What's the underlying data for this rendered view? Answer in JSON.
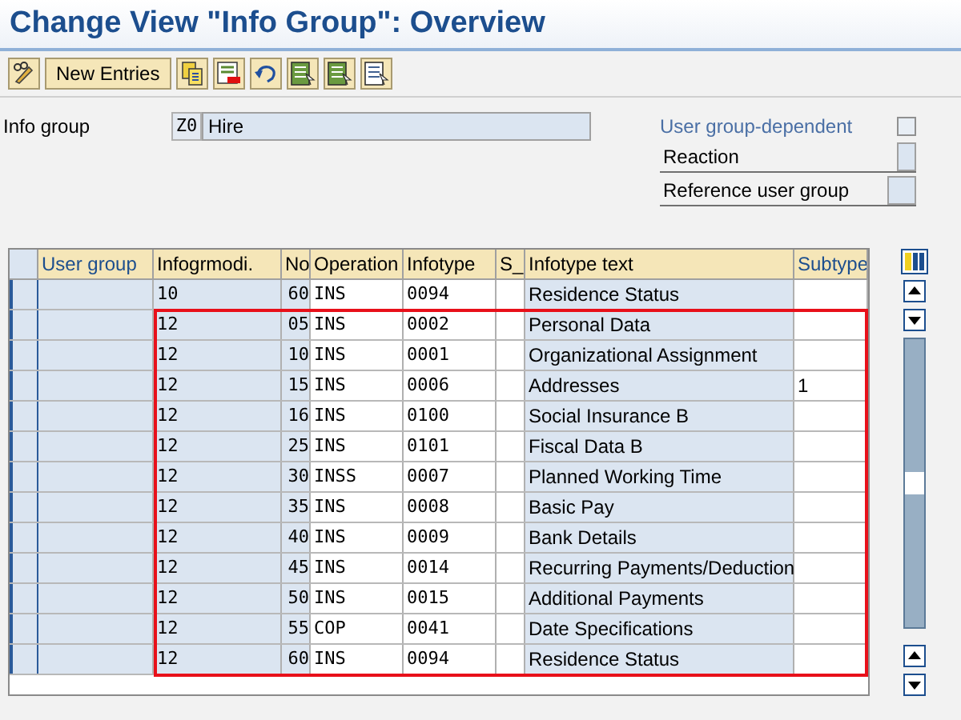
{
  "title": "Change View \"Info Group\": Overview",
  "toolbar": {
    "buttons": [
      {
        "kind": "glasses-pencil"
      },
      {
        "kind": "text",
        "label": "New Entries"
      },
      {
        "kind": "copy"
      },
      {
        "kind": "delete"
      },
      {
        "kind": "undo"
      },
      {
        "kind": "select-all"
      },
      {
        "kind": "select-block"
      },
      {
        "kind": "deselect"
      }
    ]
  },
  "header": {
    "info_group": {
      "label": "Info group",
      "code": "Z0",
      "value": "Hire"
    },
    "user_group_dependent": {
      "label": "User group-dependent",
      "checked": false
    },
    "reaction": {
      "label": "Reaction"
    },
    "reference_user_group": {
      "label": "Reference user group"
    }
  },
  "table": {
    "columns": [
      {
        "label": "User group",
        "kind": "key-text",
        "emphasized": true
      },
      {
        "label": "Infogrmodi.",
        "kind": "key-mono",
        "emphasized": false
      },
      {
        "label": "No",
        "kind": "key-num",
        "emphasized": false
      },
      {
        "label": "Operation",
        "kind": "mono",
        "emphasized": false
      },
      {
        "label": "Infotype",
        "kind": "mono",
        "emphasized": false
      },
      {
        "label": "S_",
        "kind": "plain",
        "emphasized": false
      },
      {
        "label": "Infotype text",
        "kind": "display",
        "emphasized": false
      },
      {
        "label": "Subtype",
        "kind": "plain",
        "emphasized": true
      }
    ],
    "rows": [
      {
        "infogrmodi": "10",
        "no": "60",
        "operation": "INS",
        "infotype": "0094",
        "infotype_text": "Residence Status",
        "highlighted": false
      },
      {
        "infogrmodi": "12",
        "no": "05",
        "operation": "INS",
        "infotype": "0002",
        "infotype_text": "Personal Data",
        "highlighted": true
      },
      {
        "infogrmodi": "12",
        "no": "10",
        "operation": "INS",
        "infotype": "0001",
        "infotype_text": "Organizational Assignment",
        "highlighted": true
      },
      {
        "infogrmodi": "12",
        "no": "15",
        "operation": "INS",
        "infotype": "0006",
        "infotype_text": "Addresses",
        "subtype": "1",
        "highlighted": true
      },
      {
        "infogrmodi": "12",
        "no": "16",
        "operation": "INS",
        "infotype": "0100",
        "infotype_text": "Social Insurance  B",
        "highlighted": true
      },
      {
        "infogrmodi": "12",
        "no": "25",
        "operation": "INS",
        "infotype": "0101",
        "infotype_text": "Fiscal Data B",
        "highlighted": true
      },
      {
        "infogrmodi": "12",
        "no": "30",
        "operation": "INSS",
        "infotype": "0007",
        "infotype_text": "Planned Working Time",
        "highlighted": true
      },
      {
        "infogrmodi": "12",
        "no": "35",
        "operation": "INS",
        "infotype": "0008",
        "infotype_text": "Basic Pay",
        "highlighted": true
      },
      {
        "infogrmodi": "12",
        "no": "40",
        "operation": "INS",
        "infotype": "0009",
        "infotype_text": "Bank Details",
        "highlighted": true
      },
      {
        "infogrmodi": "12",
        "no": "45",
        "operation": "INS",
        "infotype": "0014",
        "infotype_text": "Recurring Payments/Deduction",
        "highlighted": true
      },
      {
        "infogrmodi": "12",
        "no": "50",
        "operation": "INS",
        "infotype": "0015",
        "infotype_text": "Additional Payments",
        "highlighted": true
      },
      {
        "infogrmodi": "12",
        "no": "55",
        "operation": "COP",
        "infotype": "0041",
        "infotype_text": "Date Specifications",
        "highlighted": true
      },
      {
        "infogrmodi": "12",
        "no": "60",
        "operation": "INS",
        "infotype": "0094",
        "infotype_text": "Residence Status",
        "highlighted": true
      }
    ]
  }
}
